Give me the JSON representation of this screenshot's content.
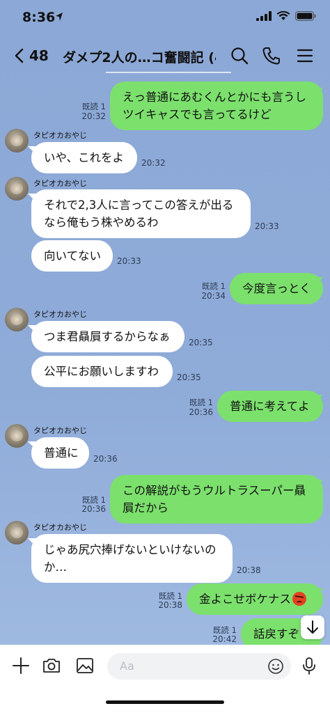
{
  "status_bar": {
    "time": "8:36"
  },
  "header": {
    "unread_count": "48",
    "title": "ダメプ2人の…コ奮闘記 (4)"
  },
  "messages": [
    {
      "side": "out",
      "lines": [
        "えっ普通にあむくんとかにも言うし",
        "ツイキャスでも言ってるけど"
      ],
      "read": "既読 1",
      "time": "20:32"
    },
    {
      "side": "in",
      "sender": "タピオカおやじ",
      "lines": [
        "いや、これをよ"
      ],
      "time": "20:32"
    },
    {
      "side": "in",
      "sender": "タピオカおやじ",
      "lines": [
        "それで2,3人に言ってこの答えが出る",
        "なら俺もう株やめるわ"
      ],
      "time": "20:33"
    },
    {
      "side": "in",
      "lines": [
        "向いてない"
      ],
      "time": "20:33"
    },
    {
      "side": "out",
      "lines": [
        "今度言っとく"
      ],
      "read": "既読 1",
      "time": "20:34"
    },
    {
      "side": "in",
      "sender": "タピオカおやじ",
      "lines": [
        "つま君贔屓するからなぁ"
      ],
      "time": "20:35"
    },
    {
      "side": "in",
      "lines": [
        "公平にお願いしますわ"
      ],
      "time": "20:35"
    },
    {
      "side": "out",
      "lines": [
        "普通に考えてよ"
      ],
      "read": "既読 1",
      "time": "20:36"
    },
    {
      "side": "in",
      "sender": "タピオカおやじ",
      "lines": [
        "普通に"
      ],
      "time": "20:36"
    },
    {
      "side": "out",
      "lines": [
        "この解説がもうウルトラスーパー贔",
        "屓だから"
      ],
      "read": "既読 1",
      "time": "20:36"
    },
    {
      "side": "in",
      "sender": "タピオカおやじ",
      "lines": [
        "じゃあ尻穴捧げないといけないの",
        "か…"
      ],
      "time": "20:38"
    },
    {
      "side": "out",
      "lines": [
        "金よこせボケナス"
      ],
      "emoji": "angry-face",
      "read": "既読 1",
      "time": "20:38"
    },
    {
      "side": "out",
      "lines": [
        "話戻すぞ"
      ],
      "read": "既読 1",
      "time": "20:42"
    }
  ],
  "input_bar": {
    "placeholder": "Aa"
  },
  "colors": {
    "outgoing_bubble": "#7ce06d",
    "incoming_bubble": "#ffffff",
    "background": "#8ca8d6"
  }
}
